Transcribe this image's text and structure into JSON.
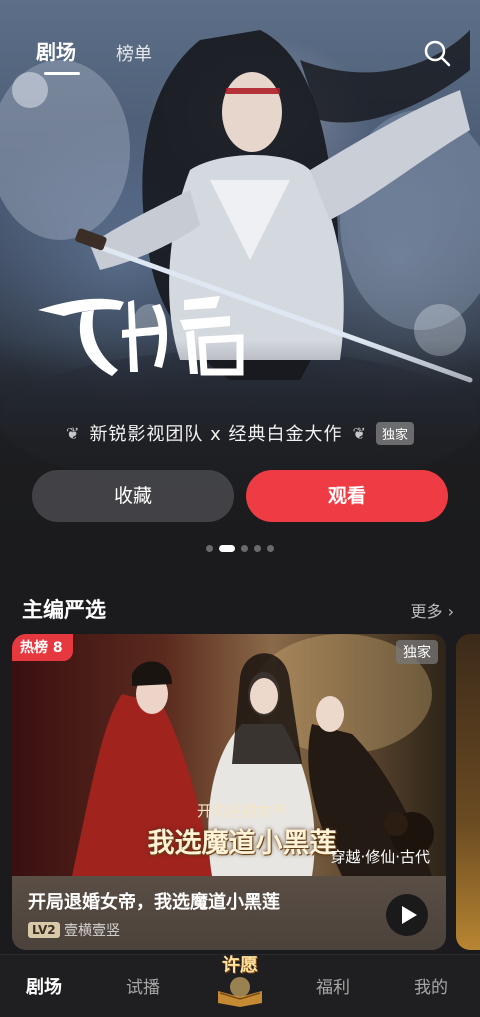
{
  "header": {
    "tabs": [
      {
        "label": "剧场",
        "active": true
      },
      {
        "label": "榜单",
        "active": false
      }
    ],
    "search_icon": "search-icon"
  },
  "hero": {
    "title_art_text": "飞升之后",
    "tagline": "新锐影视团队 x 经典白金大作",
    "exclusive_badge": "独家",
    "collect_button": "收藏",
    "watch_button": "观看",
    "carousel_total": 5,
    "carousel_active": 2,
    "accent_color": "#ee3b44"
  },
  "section": {
    "title": "主编严选",
    "more_label": "更多 ›"
  },
  "card": {
    "hot_badge": "热榜 8",
    "exclusive_badge": "独家",
    "poster_subtitle": "开局退婚女帝",
    "poster_title": "我选魔道小黑莲",
    "genre": "穿越·修仙·古代",
    "name": "开局退婚女帝，我选魔道小黑莲",
    "level": "LV2",
    "author": "壹横壹竖",
    "play_icon": "play-icon"
  },
  "bottom_nav": {
    "items": [
      {
        "label": "剧场",
        "active": true
      },
      {
        "label": "试播",
        "active": false
      },
      {
        "label": "许愿",
        "active": false
      },
      {
        "label": "福利",
        "active": false
      },
      {
        "label": "我的",
        "active": false
      }
    ]
  }
}
